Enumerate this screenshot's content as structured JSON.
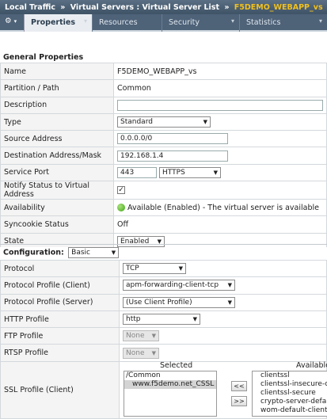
{
  "breadcrumb": {
    "parts": [
      "Local Traffic",
      "Virtual Servers : Virtual Server List"
    ],
    "separator": "»",
    "current": "F5DEMO_WEBAPP_vs"
  },
  "tabs": [
    {
      "label": "Properties",
      "active": true
    },
    {
      "label": "Resources",
      "active": false
    },
    {
      "label": "Security",
      "active": false
    },
    {
      "label": "Statistics",
      "active": false
    }
  ],
  "gear_icon": "gear-icon",
  "general": {
    "title": "General Properties",
    "rows": {
      "name": {
        "label": "Name",
        "value": "F5DEMO_WEBAPP_vs"
      },
      "partition": {
        "label": "Partition / Path",
        "value": "Common"
      },
      "description": {
        "label": "Description",
        "value": ""
      },
      "type": {
        "label": "Type",
        "value": "Standard"
      },
      "source": {
        "label": "Source Address",
        "value": "0.0.0.0/0"
      },
      "destination": {
        "label": "Destination Address/Mask",
        "value": "192.168.1.4"
      },
      "service_port": {
        "label": "Service Port",
        "port": "443",
        "protocol": "HTTPS"
      },
      "notify": {
        "label": "Notify Status to Virtual Address",
        "checked": true
      },
      "availability": {
        "label": "Availability",
        "value": "Available (Enabled) - The virtual server is available"
      },
      "syncookie": {
        "label": "Syncookie Status",
        "value": "Off"
      },
      "state": {
        "label": "State",
        "value": "Enabled"
      }
    }
  },
  "configuration": {
    "title": "Configuration:",
    "mode": "Basic",
    "rows": {
      "protocol": {
        "label": "Protocol",
        "value": "TCP"
      },
      "profile_client": {
        "label": "Protocol Profile (Client)",
        "value": "apm-forwarding-client-tcp"
      },
      "profile_server": {
        "label": "Protocol Profile (Server)",
        "value": "(Use Client Profile)"
      },
      "http": {
        "label": "HTTP Profile",
        "value": "http"
      },
      "ftp": {
        "label": "FTP Profile",
        "value": "None"
      },
      "rtsp": {
        "label": "RTSP Profile",
        "value": "None"
      },
      "ssl_client": {
        "label": "SSL Profile (Client)"
      }
    },
    "ssl": {
      "selected_header": "Selected",
      "available_header": "Available",
      "selected": [
        "/Common",
        "www.f5demo.net_CSSL"
      ],
      "available": [
        "clientssl",
        "clientssl-insecure-compatible",
        "clientssl-secure",
        "crypto-server-default-clientssl",
        "wom-default-clientssl"
      ],
      "move_left": "<<",
      "move_right": ">>"
    }
  }
}
